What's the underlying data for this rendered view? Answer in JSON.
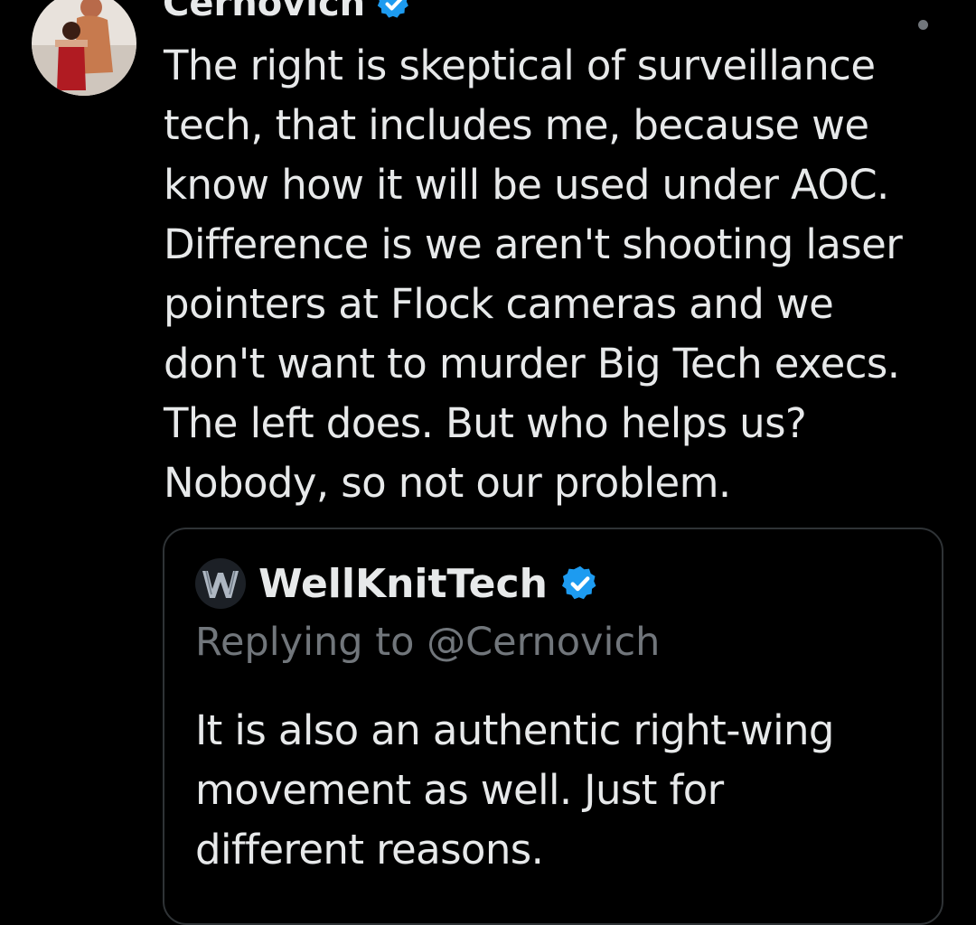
{
  "tweet": {
    "author_name": "Cernovich",
    "verified_icon": "verified-badge-icon",
    "text": "The right is skeptical of surveillance\ntech, that includes me, because we\nknow how it will be used under AOC.\nDifference is we aren't shooting laser\npointers at Flock cameras and we\ndon't want to murder Big Tech execs.\nThe left does. But who helps us?\nNobody, so not our problem."
  },
  "quote": {
    "author_name": "WellKnitTech",
    "verified_icon": "verified-badge-icon",
    "replying_to": "Replying to @Cernovich",
    "text": "It is also an authentic right-wing\nmovement as well. Just for\ndifferent reasons."
  },
  "colors": {
    "background": "#000000",
    "text_primary": "#e7e9ea",
    "text_secondary": "#71767b",
    "verified_blue": "#1d9bf0",
    "border": "#2f3336"
  }
}
